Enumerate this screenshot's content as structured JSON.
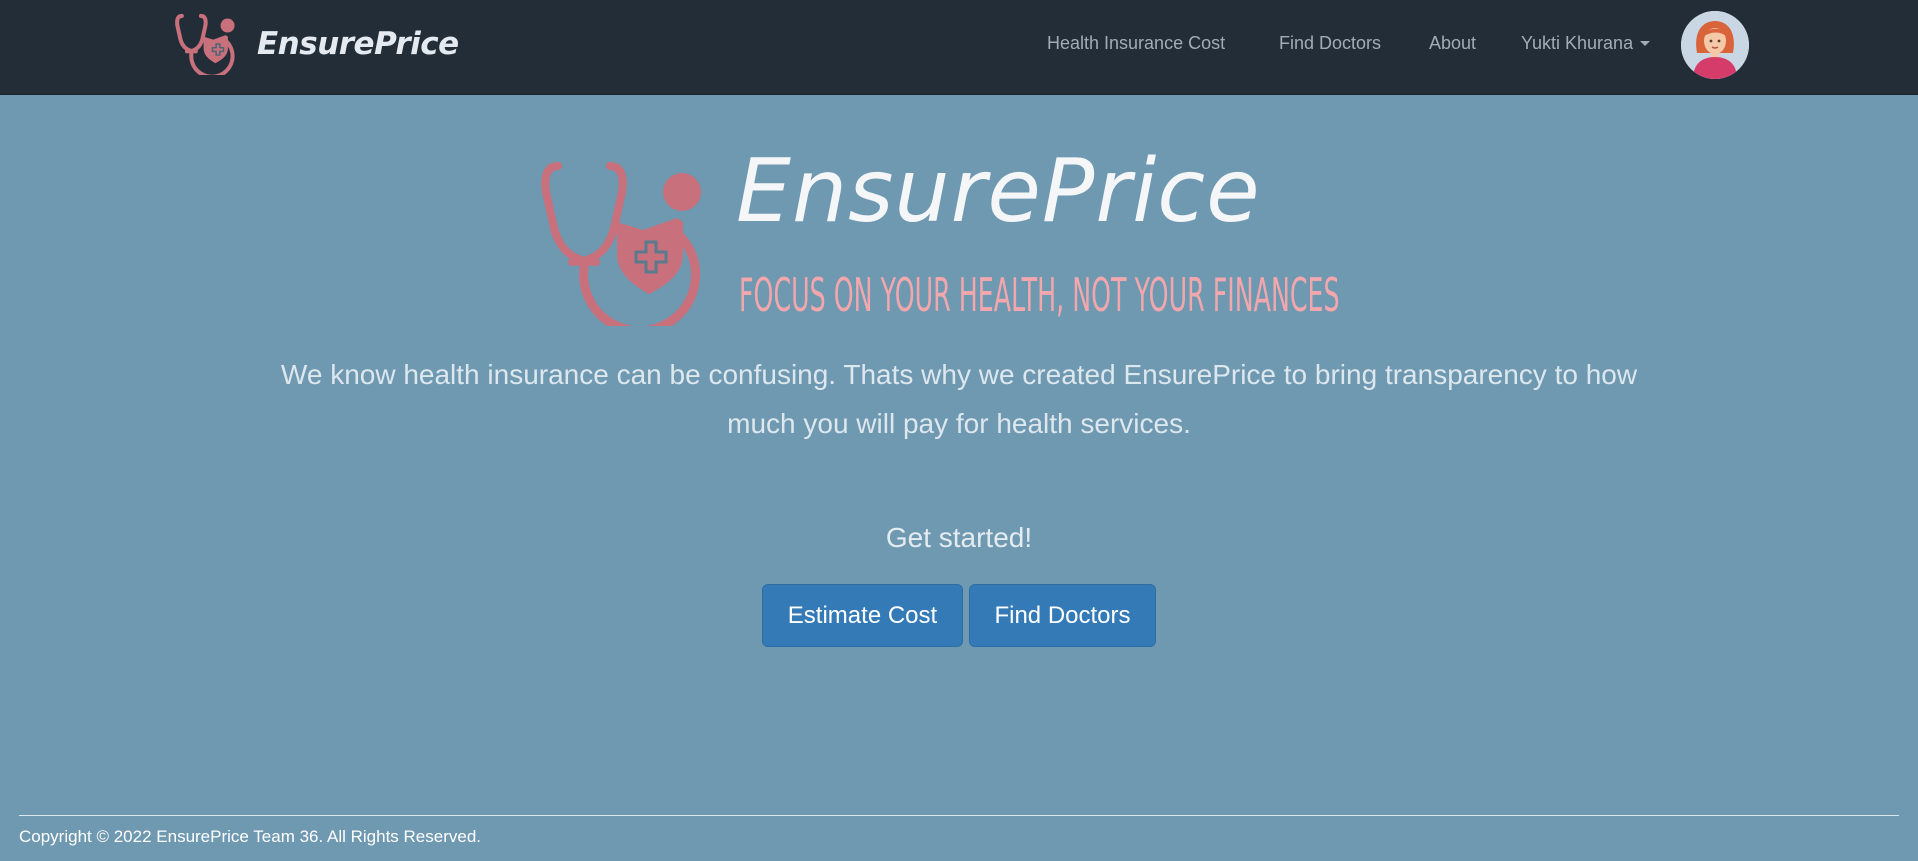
{
  "navbar": {
    "brand_name": "EnsurePrice",
    "links": [
      {
        "label": "Health Insurance Cost"
      },
      {
        "label": "Find Doctors"
      },
      {
        "label": "About"
      }
    ],
    "user_menu_label": "Yukti Khurana",
    "brand_logo_icon": "stethoscope-shield-icon",
    "avatar_icon": "user-avatar"
  },
  "hero": {
    "title": "EnsurePrice",
    "tagline": "FOCUS ON YOUR HEALTH, NOT YOUR FINANCES",
    "description": "We know health insurance can be confusing. Thats why we created EnsurePrice to bring transparency to how much you will pay for health services.",
    "get_started": "Get started!",
    "logo_icon": "stethoscope-shield-icon"
  },
  "buttons": {
    "estimate_cost": "Estimate Cost",
    "find_doctors": "Find Doctors"
  },
  "footer": {
    "copyright": "Copyright © 2022 EnsurePrice Team 36. All Rights Reserved."
  },
  "colors": {
    "navbar_bg": "#222d37",
    "page_bg": "#6f98b1",
    "logo_red": "#c8707b",
    "tagline_pink": "#f2a7ad",
    "button_blue": "#337ab7"
  }
}
